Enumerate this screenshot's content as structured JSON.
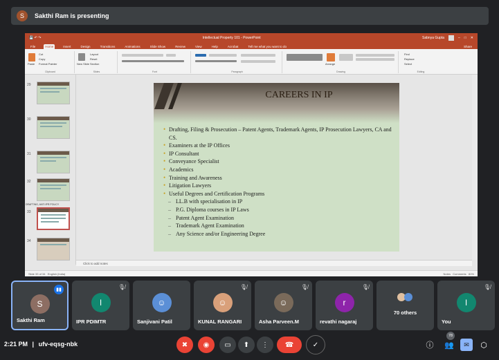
{
  "presenter": {
    "avatar_letter": "S",
    "text": "Sakthi Ram is presenting"
  },
  "powerpoint": {
    "title": "Intellectual Property 101 - PowerPoint",
    "user": "Sabnya Gupta",
    "tabs": [
      "File",
      "Home",
      "Insert",
      "Design",
      "Transitions",
      "Animations",
      "Slide Show",
      "Review",
      "View",
      "Help",
      "Acrobat",
      "Tell me what you want to do"
    ],
    "active_tab": "Home",
    "share": "Share",
    "ribbon_groups": [
      "Clipboard",
      "Slides",
      "Font",
      "Paragraph",
      "Drawing",
      "Editing"
    ],
    "clipboard": {
      "paste": "Paste",
      "cut": "Cut",
      "copy": "Copy",
      "format_painter": "Format Painter"
    },
    "slides_group": {
      "new_slide": "New Slide",
      "layout": "Layout",
      "reset": "Reset",
      "section": "Section"
    },
    "editing": {
      "find": "Find",
      "replace": "Replace",
      "select": "Select"
    },
    "arrange": "Arrange",
    "thumbnails": [
      {
        "num": "29"
      },
      {
        "num": "30"
      },
      {
        "num": "31"
      },
      {
        "num": "32"
      },
      {
        "num": "33",
        "selected": true
      },
      {
        "num": "34"
      }
    ],
    "section_caption": "DRAFTING, ANTI IPR POLICY",
    "slide": {
      "title": "CAREERS IN IP",
      "bullets": [
        {
          "level": 1,
          "text": "Drafting, Filing & Prosecution – Patent Agents, Trademark Agents, IP Prosecution Lawyers, CA and CS."
        },
        {
          "level": 1,
          "text": "Examiners at the IP Offices"
        },
        {
          "level": 1,
          "text": "IP Consultant"
        },
        {
          "level": 1,
          "text": "Conveyance Specialist"
        },
        {
          "level": 1,
          "text": "Academics"
        },
        {
          "level": 1,
          "text": "Training and Awareness"
        },
        {
          "level": 1,
          "text": "Litigation Lawyers"
        },
        {
          "level": 1,
          "text": "Useful Degrees and Certification Programs"
        },
        {
          "level": 2,
          "text": "LL.B with specialisation in IP"
        },
        {
          "level": 2,
          "text": "P.G. Diploma courses in IP Laws"
        },
        {
          "level": 2,
          "text": "Patent Agent Examination"
        },
        {
          "level": 2,
          "text": "Trademark Agent Examination"
        },
        {
          "level": 2,
          "text": "Any Science and/or Engineering Degree"
        }
      ]
    },
    "notes_placeholder": "Click to add notes",
    "status_left": "Slide 33 of 34",
    "status_lang": "English (India)",
    "status_notes": "Notes",
    "status_comments": "Comments",
    "zoom": "81%"
  },
  "participants": [
    {
      "name": "Sakthi Ram",
      "letter": "S",
      "color": "#8d6e63",
      "speaking": true
    },
    {
      "name": "IPR PDIMTR",
      "letter": "I",
      "color": "#12876f",
      "muted": true
    },
    {
      "name": "Sanjivani Patil",
      "letter": "",
      "color": "#5b8fd6",
      "muted": false
    },
    {
      "name": "KUNAL RANGARI",
      "letter": "",
      "color": "#d9a07a",
      "muted": true
    },
    {
      "name": "Asha Parveen.M",
      "letter": "",
      "color": "#7a6a5a",
      "muted": true
    },
    {
      "name": "revathi nagaraj",
      "letter": "r",
      "color": "#8e24aa",
      "muted": true
    },
    {
      "name": "70 others",
      "letter": "",
      "color": "#3c4043"
    },
    {
      "name": "You",
      "letter": "I",
      "color": "#12876f",
      "muted": true
    }
  ],
  "bottom": {
    "clock": "2:21 PM",
    "separator": "|",
    "meeting_code": "ufv-eqsg-nbk",
    "people_count": "78"
  }
}
